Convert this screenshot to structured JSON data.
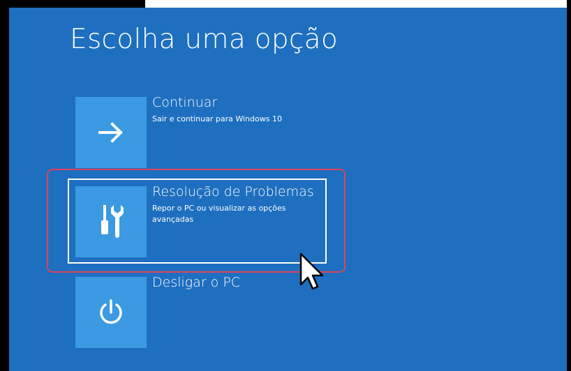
{
  "page": {
    "title": "Escolha uma opção"
  },
  "options": [
    {
      "title": "Continuar",
      "description": "Sair e continuar para Windows 10",
      "icon": "arrow-right-icon"
    },
    {
      "title": "Resolução de Problemas",
      "description": "Repor o PC ou visualizar as opções avançadas",
      "icon": "tools-icon",
      "selected": true
    },
    {
      "title": "Desligar o PC",
      "description": "",
      "icon": "power-icon"
    }
  ],
  "colors": {
    "background": "#1e6fbf",
    "tile": "#3b9ae1",
    "text": "#ffffff",
    "highlight": "#e0435a"
  }
}
